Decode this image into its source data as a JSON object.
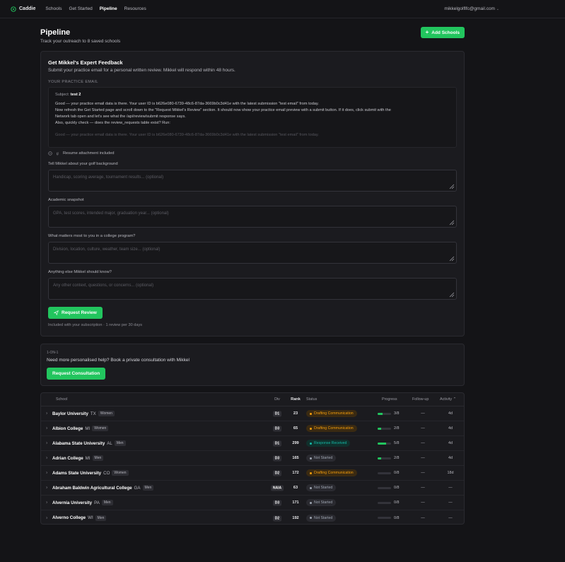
{
  "nav": {
    "brand": "Caddie",
    "links": [
      "Schools",
      "Get Started",
      "Pipeline",
      "Resources"
    ],
    "active": "Pipeline",
    "user": "mikkelgolflfc@gmail.com"
  },
  "header": {
    "title": "Pipeline",
    "subtitle": "Track your outreach to 8 saved schools",
    "add_label": "Add Schools"
  },
  "feedback": {
    "title": "Get Mikkel's Expert Feedback",
    "subtitle": "Submit your practice email for a personal written review. Mikkel will respond within 48 hours.",
    "section_label": "YOUR PRACTICE EMAIL",
    "subject_label": "Subject:",
    "subject": "test 2",
    "body_lines": [
      "Good — your practice email data is there. Your user ID is b626e080-6739-48c6-87da-3669b0c3d41e with the latest submission \"test email\" from today.",
      "Now refresh the Get Started page and scroll down to the \"Request Mikkel's Review\" section. It should now show your practice email preview with a submit button. If it does, click submit with the",
      "Network tab open and let's see what the /api/review/submit response says.",
      "Also, quickly check — does the review_requests table exist? Run:"
    ],
    "faded_line": "Good — your practice email data is there. Your user ID is b626e080-6739-48c6-87da-3669b0c3d41e with the latest submission \"test email\" from today.",
    "attachment": "Resume attachment included",
    "fields": [
      {
        "label": "Tell Mikkel about your golf background",
        "placeholder": "Handicap, scoring average, tournament results... (optional)"
      },
      {
        "label": "Academic snapshot",
        "placeholder": "GPA, test scores, intended major, graduation year... (optional)"
      },
      {
        "label": "What matters most to you in a college program?",
        "placeholder": "Division, location, culture, weather, team size... (optional)"
      },
      {
        "label": "Anything else Mikkel should know?",
        "placeholder": "Any other context, questions, or concerns... (optional)"
      }
    ],
    "submit_label": "Request Review",
    "note": "Included with your subscription · 1 review per 30 days"
  },
  "consult": {
    "eyebrow": "1-ON-1",
    "question": "Need more personalised help? Book a private consultation with Mikkel",
    "button": "Request Consultation"
  },
  "table": {
    "headers": {
      "school": "School",
      "div": "Div",
      "rank": "Rank",
      "status": "Status",
      "progress": "Progress",
      "followup": "Follow-up",
      "activity": "Activity"
    },
    "rows": [
      {
        "name": "Baylor University",
        "state": "TX",
        "gender": "Women",
        "div": "D1",
        "rank": "23",
        "status": "Drafting Communication",
        "progress": 3,
        "progress_text": "3/8",
        "followup": "—",
        "activity": "4d"
      },
      {
        "name": "Albion College",
        "state": "MI",
        "gender": "Women",
        "div": "D3",
        "rank": "65",
        "status": "Drafting Communication",
        "progress": 2,
        "progress_text": "2/8",
        "followup": "—",
        "activity": "4d"
      },
      {
        "name": "Alabama State University",
        "state": "AL",
        "gender": "Men",
        "div": "D1",
        "rank": "299",
        "status": "Response Received",
        "progress": 5,
        "progress_text": "5/8",
        "followup": "—",
        "activity": "4d"
      },
      {
        "name": "Adrian College",
        "state": "MI",
        "gender": "Men",
        "div": "D3",
        "rank": "165",
        "status": "Not Started",
        "progress": 2,
        "progress_text": "2/8",
        "followup": "—",
        "activity": "4d"
      },
      {
        "name": "Adams State University",
        "state": "CO",
        "gender": "Women",
        "div": "D2",
        "rank": "172",
        "status": "Drafting Communication",
        "progress": 0,
        "progress_text": "0/8",
        "followup": "—",
        "activity": "18d"
      },
      {
        "name": "Abraham Baldwin Agricultural College",
        "state": "GA",
        "gender": "Men",
        "div": "NAIA",
        "rank": "63",
        "status": "Not Started",
        "progress": 0,
        "progress_text": "0/8",
        "followup": "—",
        "activity": "—"
      },
      {
        "name": "Alvernia University",
        "state": "PA",
        "gender": "Men",
        "div": "D3",
        "rank": "171",
        "status": "Not Started",
        "progress": 0,
        "progress_text": "0/8",
        "followup": "—",
        "activity": "—"
      },
      {
        "name": "Alverno College",
        "state": "WI",
        "gender": "Men",
        "div": "D2",
        "rank": "192",
        "status": "Not Started",
        "progress": 0,
        "progress_text": "0/8",
        "followup": "—",
        "activity": "—"
      }
    ]
  },
  "colors": {
    "accent": "#22c55e",
    "drafting": "#f59e0b",
    "response": "#14b8a6",
    "not_started": "#9ca3af"
  }
}
